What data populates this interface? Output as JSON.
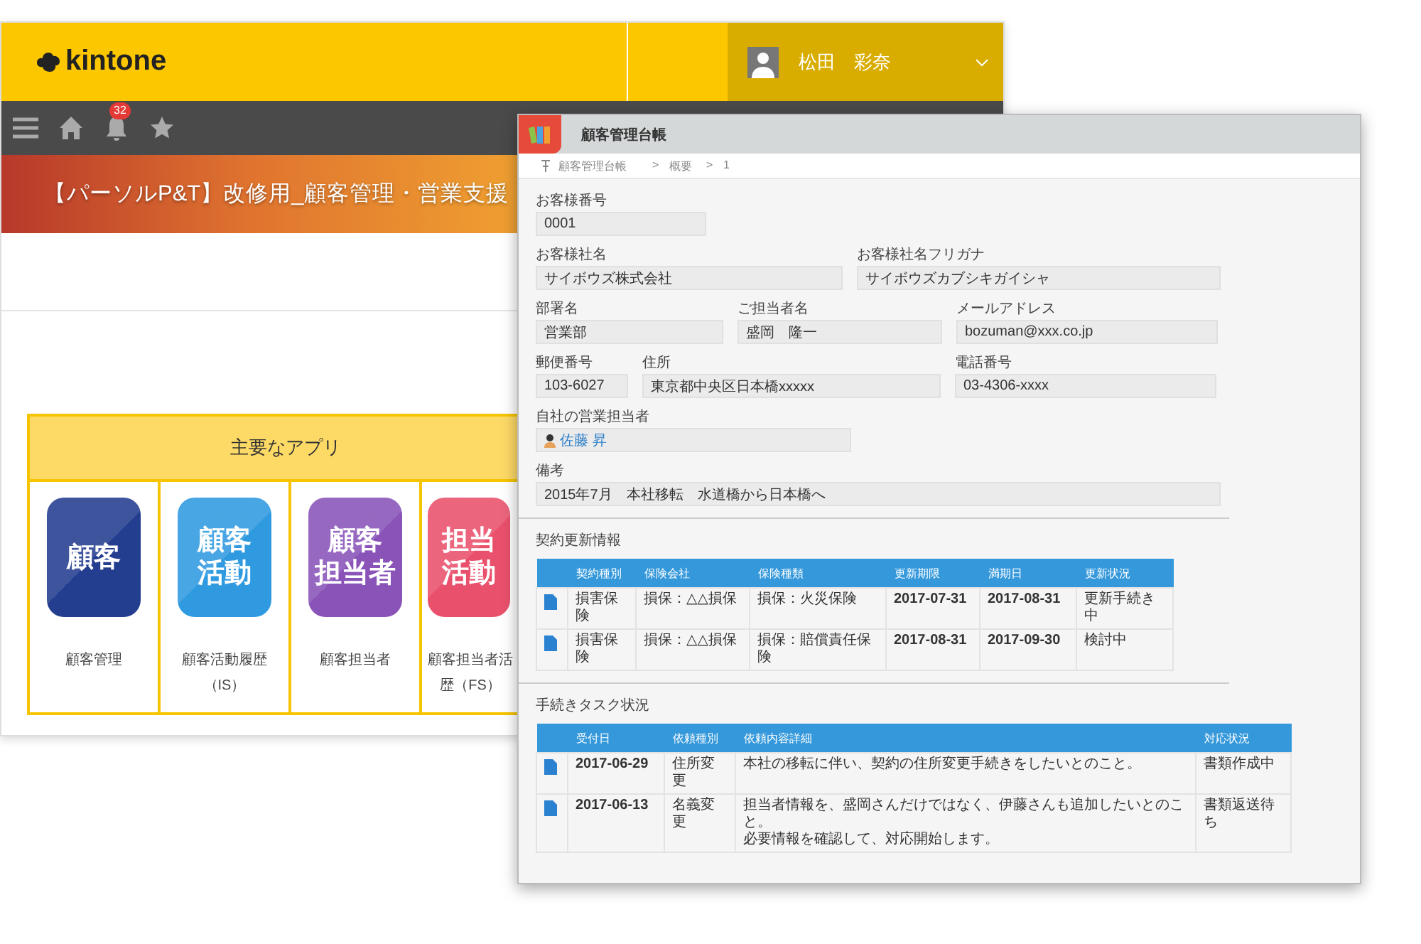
{
  "back_window": {
    "logo": "kintone",
    "user": {
      "name": "松田　彩奈"
    },
    "notification_badge": "32",
    "banner_title": "【パーソルP&T】改修用_顧客管理・営業支援",
    "apps_panel": {
      "title": "主要なアプリ",
      "apps": [
        {
          "icon_lines": [
            "顧客"
          ],
          "label_lines": [
            "顧客管理"
          ],
          "color": "#233d8f"
        },
        {
          "icon_lines": [
            "顧客",
            "活動"
          ],
          "label_lines": [
            "顧客活動履歴",
            "（IS）"
          ],
          "color": "#2f9ae0"
        },
        {
          "icon_lines": [
            "顧客",
            "担当者"
          ],
          "label_lines": [
            "顧客担当者"
          ],
          "color": "#8953b8"
        },
        {
          "icon_lines": [
            "担当",
            "活動"
          ],
          "label_lines": [
            "顧客担当者活",
            "歴（FS）"
          ],
          "color": "#e9506b"
        }
      ]
    }
  },
  "front_window": {
    "title": "顧客管理台帳",
    "breadcrumb": [
      "顧客管理台帳",
      ">",
      "概要",
      ">",
      "1"
    ],
    "field_rows": [
      [
        {
          "kind": "text",
          "label": "お客様番号",
          "value": "0001"
        }
      ],
      [
        {
          "kind": "text",
          "label": "お客様社名",
          "value": "サイボウズ株式会社"
        },
        {
          "kind": "text",
          "label": "お客様社名フリガナ",
          "value": "サイボウズカブシキガイシャ"
        }
      ],
      [
        {
          "kind": "text",
          "label": "部署名",
          "value": "営業部"
        },
        {
          "kind": "text",
          "label": "ご担当者名",
          "value": "盛岡　隆一"
        },
        {
          "kind": "text",
          "label": "メールアドレス",
          "value": "bozuman@xxx.co.jp"
        }
      ],
      [
        {
          "kind": "text",
          "label": "郵便番号",
          "value": "103-6027"
        },
        {
          "kind": "text",
          "label": "住所",
          "value": "東京都中央区日本橋xxxxx"
        },
        {
          "kind": "text",
          "label": "電話番号",
          "value": "03-4306-xxxx"
        }
      ],
      [
        {
          "kind": "user",
          "label": "自社の営業担当者",
          "value": "佐藤 昇"
        }
      ],
      [
        {
          "kind": "text",
          "label": "備考",
          "value": "2015年7月　本社移転　水道橋から日本橋へ"
        }
      ]
    ],
    "tables": [
      {
        "title": "契約更新情報",
        "columns": [
          "契約種別",
          "保険会社",
          "保険種類",
          "更新期限",
          "満期日",
          "更新状況"
        ],
        "rows": [
          [
            "損害保険",
            "損保：△△損保",
            "損保：火災保険",
            "2017-07-31",
            "2017-08-31",
            "更新手続き中"
          ],
          [
            "損害保険",
            "損保：△△損保",
            "損保：賠償責任保険",
            "2017-08-31",
            "2017-09-30",
            "検討中"
          ]
        ]
      },
      {
        "title": "手続きタスク状況",
        "columns": [
          "受付日",
          "依頼種別",
          "依頼内容詳細",
          "対応状況"
        ],
        "rows": [
          [
            "2017-06-29",
            "住所変更",
            "本社の移転に伴い、契約の住所変更手続きをしたいとのこと。",
            "書類作成中"
          ],
          [
            "2017-06-13",
            "名義変更",
            [
              "担当者情報を、盛岡さんだけではなく、伊藤さんも追加したいとのこと。",
              "必要情報を確認して、対応開始します。"
            ],
            "書類返送待ち"
          ]
        ]
      }
    ]
  }
}
